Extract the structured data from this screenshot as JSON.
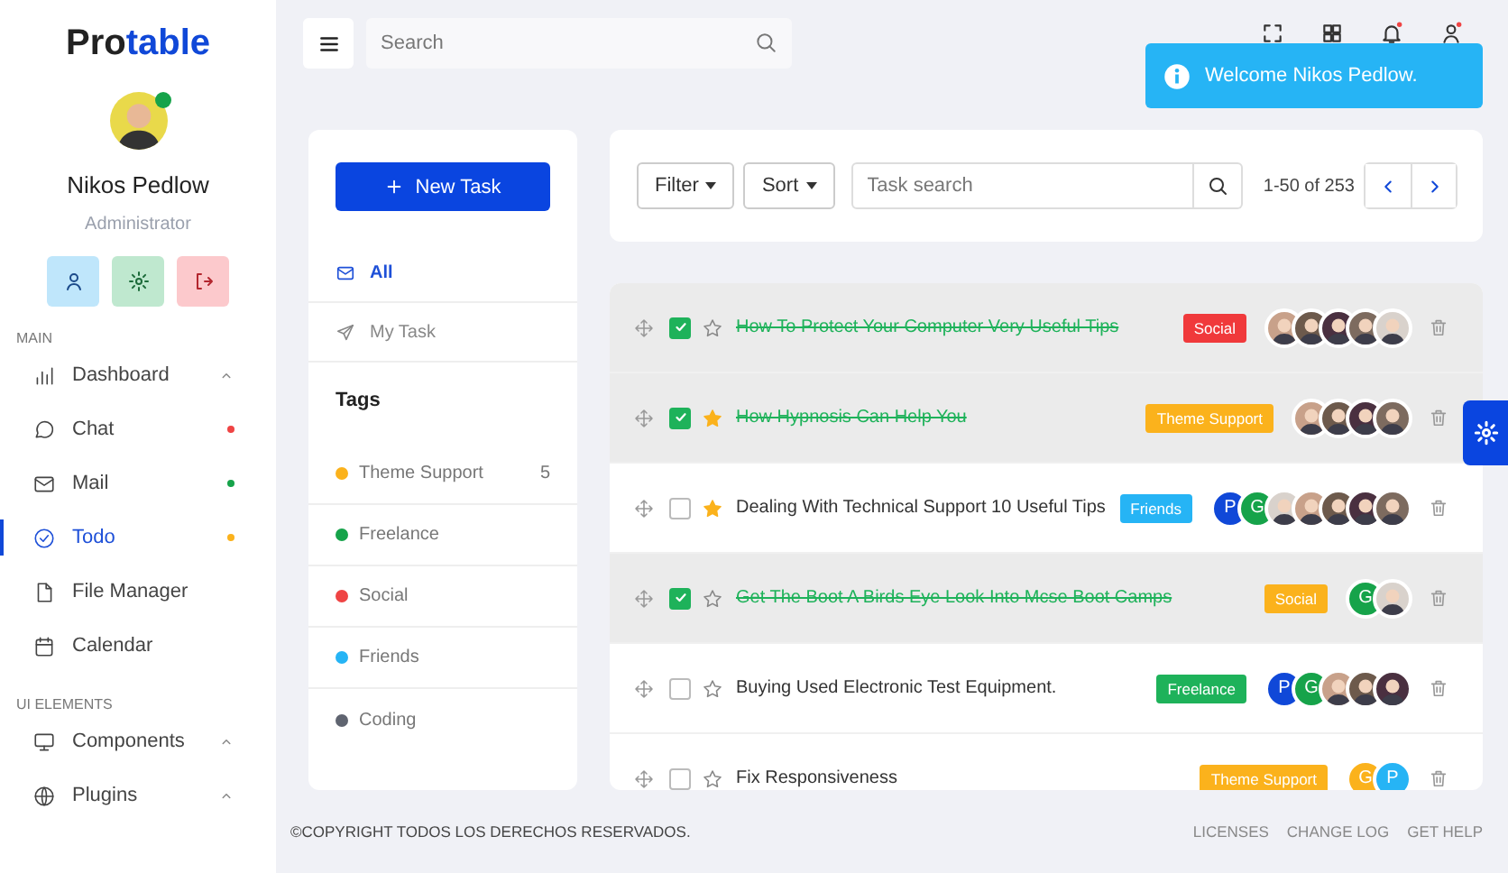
{
  "sidebar": {
    "logo": {
      "dark": "Pro",
      "accent": "table"
    },
    "user": {
      "name": "Nikos Pedlow",
      "role": "Administrator",
      "online": true
    },
    "sections": [
      {
        "title": "MAIN",
        "items": [
          {
            "label": "Dashboard",
            "kind": "group",
            "selected": false
          },
          {
            "label": "Chat",
            "kind": "link",
            "color": "#ef4444",
            "selected": false
          },
          {
            "label": "Mail",
            "kind": "link",
            "color": "#16a34a",
            "selected": false
          },
          {
            "label": "Todo",
            "kind": "link",
            "color": "#fbb21c",
            "selected": true
          },
          {
            "label": "File Manager",
            "kind": "link",
            "selected": false
          },
          {
            "label": "Calendar",
            "kind": "link",
            "selected": false
          }
        ]
      },
      {
        "title": "UI ELEMENTS",
        "items": [
          {
            "label": "Components",
            "kind": "group",
            "selected": false
          },
          {
            "label": "Plugins",
            "kind": "group",
            "selected": false
          }
        ]
      }
    ]
  },
  "header": {
    "search": {
      "placeholder": "Search"
    },
    "toast": {
      "message": "Welcome Nikos Pedlow."
    }
  },
  "todo_menu": {
    "new_task_button": "New Task",
    "folders": [
      {
        "label": "All",
        "selected": true
      },
      {
        "label": "My Task",
        "selected": false
      }
    ],
    "tags_title": "Tags",
    "tags": [
      {
        "label": "Theme Support",
        "color": "#fbb21c",
        "count": "5"
      },
      {
        "label": "Freelance",
        "color": "#16a34a"
      },
      {
        "label": "Social",
        "color": "#ef4444"
      },
      {
        "label": "Friends",
        "color": "#26b4f5"
      },
      {
        "label": "Coding",
        "color": "#5f6470"
      }
    ]
  },
  "toolbar": {
    "filter": "Filter",
    "sort": "Sort",
    "search": {
      "placeholder": "Task search"
    },
    "range": "1-50 of 253"
  },
  "tasks": [
    {
      "title": "How To Protect Your Computer Very Useful Tips",
      "done": true,
      "starred": false,
      "tag": {
        "label": "Social",
        "color": "#f0393b"
      },
      "assignees": [
        {
          "kind": "photo"
        },
        {
          "kind": "photo"
        },
        {
          "kind": "photo"
        },
        {
          "kind": "photo"
        },
        {
          "kind": "photo"
        }
      ]
    },
    {
      "title": "How Hypnosis Can Help You",
      "done": true,
      "starred": true,
      "tag": {
        "label": "Theme Support",
        "color": "#fbb21c"
      },
      "assignees": [
        {
          "kind": "photo"
        },
        {
          "kind": "photo"
        },
        {
          "kind": "photo"
        },
        {
          "kind": "photo"
        }
      ]
    },
    {
      "title": "Dealing With Technical Support 10 Useful Tips",
      "done": false,
      "starred": true,
      "tag": {
        "label": "Friends",
        "color": "#26b4f5"
      },
      "assignees": [
        {
          "kind": "letter",
          "text": "P",
          "color": "#1048d8"
        },
        {
          "kind": "letter",
          "text": "G",
          "color": "#16a34a"
        },
        {
          "kind": "photo"
        },
        {
          "kind": "photo"
        },
        {
          "kind": "photo"
        },
        {
          "kind": "photo"
        },
        {
          "kind": "photo"
        }
      ]
    },
    {
      "title": "Get The Boot A Birds Eye Look Into Mcse Boot Camps",
      "done": true,
      "starred": false,
      "tag": {
        "label": "Social",
        "color": "#fbb21c"
      },
      "assignees": [
        {
          "kind": "letter",
          "text": "G",
          "color": "#16a34a"
        },
        {
          "kind": "photo"
        }
      ]
    },
    {
      "title": "Buying Used Electronic Test Equipment.",
      "done": false,
      "starred": false,
      "tag": {
        "label": "Freelance",
        "color": "#1eb25a"
      },
      "assignees": [
        {
          "kind": "letter",
          "text": "P",
          "color": "#1048d8"
        },
        {
          "kind": "letter",
          "text": "G",
          "color": "#16a34a"
        },
        {
          "kind": "photo"
        },
        {
          "kind": "photo"
        },
        {
          "kind": "photo"
        }
      ]
    },
    {
      "title": "Fix Responsiveness",
      "done": false,
      "starred": false,
      "tag": {
        "label": "Theme Support",
        "color": "#fbb21c"
      },
      "assignees": [
        {
          "kind": "letter",
          "text": "G",
          "color": "#fbb21c"
        },
        {
          "kind": "letter",
          "text": "P",
          "color": "#26b4f5"
        }
      ]
    }
  ],
  "footer": {
    "copyright": "©COPYRIGHT TODOS LOS DERECHOS RESERVADOS.",
    "links": [
      "LICENSES",
      "CHANGE LOG",
      "GET HELP"
    ]
  }
}
